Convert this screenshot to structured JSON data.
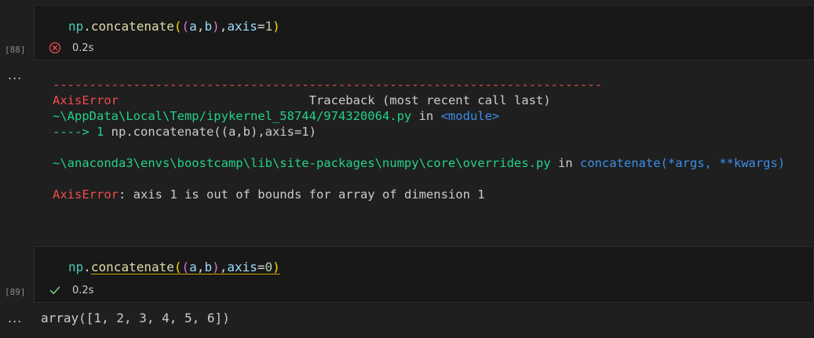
{
  "cells": [
    {
      "execution_count": "[88]",
      "code": {
        "obj": "np",
        "dot": ".",
        "fn": "concatenate",
        "open1": "(",
        "open2": "(",
        "arg_a": "a",
        "comma1": ",",
        "arg_b": "b",
        "close2": ")",
        "comma2": ",",
        "kw": "axis",
        "eq": "=",
        "num": "1",
        "close1": ")"
      },
      "status": {
        "icon": "error-circle-icon",
        "time": "0.2s"
      },
      "output_toggle": "...",
      "output": {
        "dashes": "---------------------------------------------------------------------------",
        "error_name": "AxisError",
        "traceback_gap": "                          ",
        "traceback_label": "Traceback (most recent call last)",
        "file1_path": "~\\AppData\\Local\\Temp/ipykernel_58744/974320064.py",
        "file1_in": " in ",
        "file1_func": "<module>",
        "arrow": "----> 1 ",
        "arrow_code": "np.concatenate((a,b),axis=1)",
        "file2_path": "~\\anaconda3\\envs\\boostcamp\\lib\\site-packages\\numpy\\core\\overrides.py",
        "file2_in": " in ",
        "file2_func": "concatenate(*args, **kwargs)",
        "error_final_name": "AxisError",
        "error_message": ": axis 1 is out of bounds for array of dimension 1"
      }
    },
    {
      "execution_count": "[89]",
      "code": {
        "obj": "np",
        "dot": ".",
        "fn": "concatenate",
        "open1": "(",
        "open2": "(",
        "arg_a": "a",
        "comma1": ",",
        "arg_b": "b",
        "close2": ")",
        "comma2": ",",
        "kw": "axis",
        "eq": "=",
        "num": "0",
        "close1": ")"
      },
      "status": {
        "icon": "checkmark-icon",
        "time": "0.2s"
      },
      "output_toggle": "...",
      "output": {
        "text": "array([1, 2, 3, 4, 5, 6])"
      }
    }
  ],
  "colors": {
    "background": "#1f1f1f",
    "cell_background": "#181818",
    "error_red": "#f14c4c",
    "success_green": "#89d185",
    "traceback_green": "#23d18b",
    "traceback_blue": "#3b8eea"
  }
}
